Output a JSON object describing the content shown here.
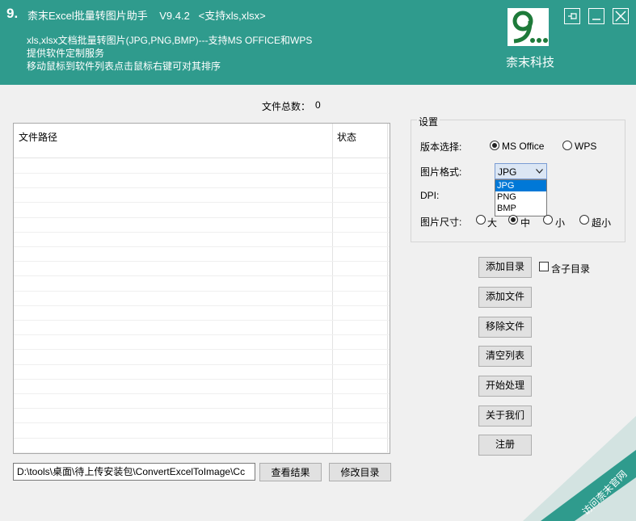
{
  "window": {
    "title": "柰末Excel批量转图片助手    V9.4.2   <支持xls,xlsx>",
    "app_icon_text": "9.",
    "controls": [
      "pin-icon",
      "minimize-icon",
      "close-icon"
    ]
  },
  "header": {
    "line1": "xls,xlsx文档批量转图片(JPG,PNG,BMP)---支持MS OFFICE和WPS",
    "line2": "提供软件定制服务",
    "line3": "移动鼠标到软件列表点击鼠标右键可对其排序",
    "logo_mark": "9...",
    "logo_text": "柰末科技"
  },
  "file_count": {
    "label": "文件总数：",
    "value": "0"
  },
  "table": {
    "columns": [
      "文件路径",
      "状态"
    ],
    "rows": []
  },
  "settings": {
    "title": "设置",
    "version_label": "版本选择:",
    "version_options": [
      "MS Office",
      "WPS"
    ],
    "version_selected": "MS Office",
    "format_label": "图片格式:",
    "format_value": "JPG",
    "format_options": [
      "JPG",
      "PNG",
      "BMP"
    ],
    "dpi_label": "DPI:",
    "size_label": "图片尺寸:",
    "size_options": [
      "大",
      "中",
      "小",
      "超小"
    ],
    "size_selected": "中"
  },
  "buttons": {
    "add_dir": "添加目录",
    "include_subdir": "含子目录",
    "add_file": "添加文件",
    "remove_file": "移除文件",
    "clear_list": "清空列表",
    "start": "开始处理",
    "about": "关于我们",
    "register": "注册",
    "view_result": "查看结果",
    "change_dir": "修改目录"
  },
  "output_path": "D:\\tools\\桌面\\待上传安装包\\ConvertExcelToImage\\Cc",
  "corner_ribbon": "访问柰末官网",
  "colors": {
    "header_bg": "#2f9b8d",
    "logo_green": "#1e7a3a",
    "selection": "#0078d7"
  }
}
